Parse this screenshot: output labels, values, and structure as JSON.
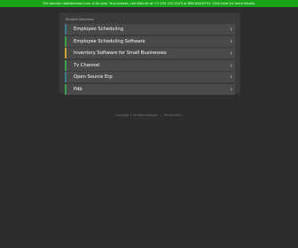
{
  "banner": {
    "text": "The domain reallsdomain.com is for sale. To purchase, call Afternic at +1 339-222-5143 or 866-836-6791. Click here for more details."
  },
  "panel": {
    "heading": "Related Searches:",
    "links": [
      {
        "label": "Employee Scheduling",
        "accent": "#3a7c96"
      },
      {
        "label": "Employee Scheduling Software",
        "accent": "#3ca24a"
      },
      {
        "label": "Inventory Software for Small Businesses",
        "accent": "#c9a62a"
      },
      {
        "label": "Tv Channel",
        "accent": "#3ca24a"
      },
      {
        "label": "Open Source Erp",
        "accent": "#3a7c96"
      },
      {
        "label": "Pdb",
        "accent": "#3ca24a"
      }
    ],
    "chevron_icon": "chevron-right-icon"
  },
  "footer": {
    "copyright": "Copyright © All rights reserved.",
    "privacy": "Privacy Policy"
  }
}
